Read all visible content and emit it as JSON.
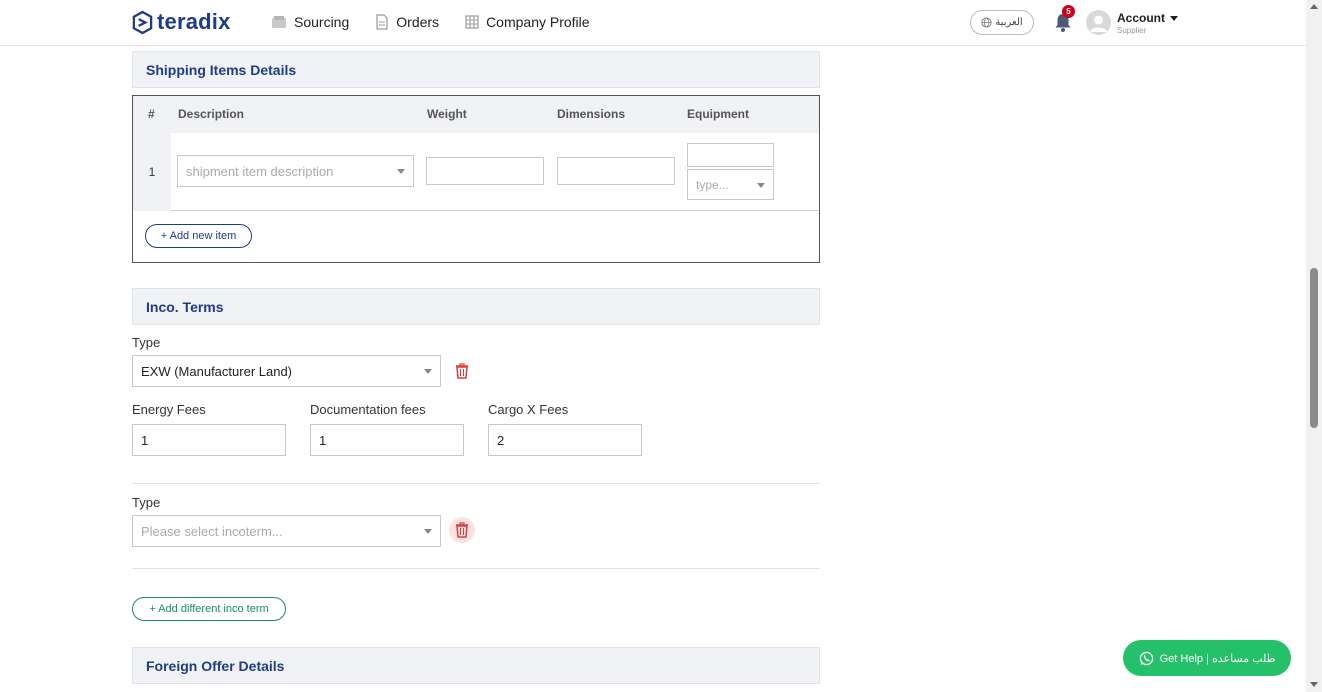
{
  "header": {
    "brand": "teradix",
    "nav": [
      {
        "label": "Sourcing",
        "icon": "inbox-icon"
      },
      {
        "label": "Orders",
        "icon": "document-icon"
      },
      {
        "label": "Company Profile",
        "icon": "building-icon"
      }
    ],
    "language_label": "العربية",
    "notification_count": "5",
    "account_label": "Account",
    "account_role": "Supplier"
  },
  "shipping": {
    "title": "Shipping Items Details",
    "columns": [
      "#",
      "Description",
      "Weight",
      "Dimensions",
      "Equipment"
    ],
    "rows": [
      {
        "index": "1",
        "description_placeholder": "shipment item description",
        "weight": "",
        "dimensions": "",
        "equipment_qty": "",
        "equipment_type_placeholder": "type..."
      }
    ],
    "add_button": "+ Add new item"
  },
  "inco": {
    "title": "Inco. Terms",
    "terms": [
      {
        "type_label": "Type",
        "type_value": "EXW (Manufacturer Land)",
        "fees": [
          {
            "label": "Energy Fees",
            "value": "1"
          },
          {
            "label": "Documentation fees",
            "value": "1"
          },
          {
            "label": "Cargo X Fees",
            "value": "2"
          }
        ]
      },
      {
        "type_label": "Type",
        "type_placeholder": "Please select incoterm..."
      }
    ],
    "add_button": "+ Add different inco term"
  },
  "foreign": {
    "title": "Foreign Offer Details"
  },
  "help_button": "Get Help | طلب مساعده",
  "colors": {
    "brand": "#1f3c88",
    "accent_green": "#1a8f5f",
    "help_green": "#25c16a",
    "danger": "#d0021b",
    "section_bg": "#f0f2f6"
  }
}
